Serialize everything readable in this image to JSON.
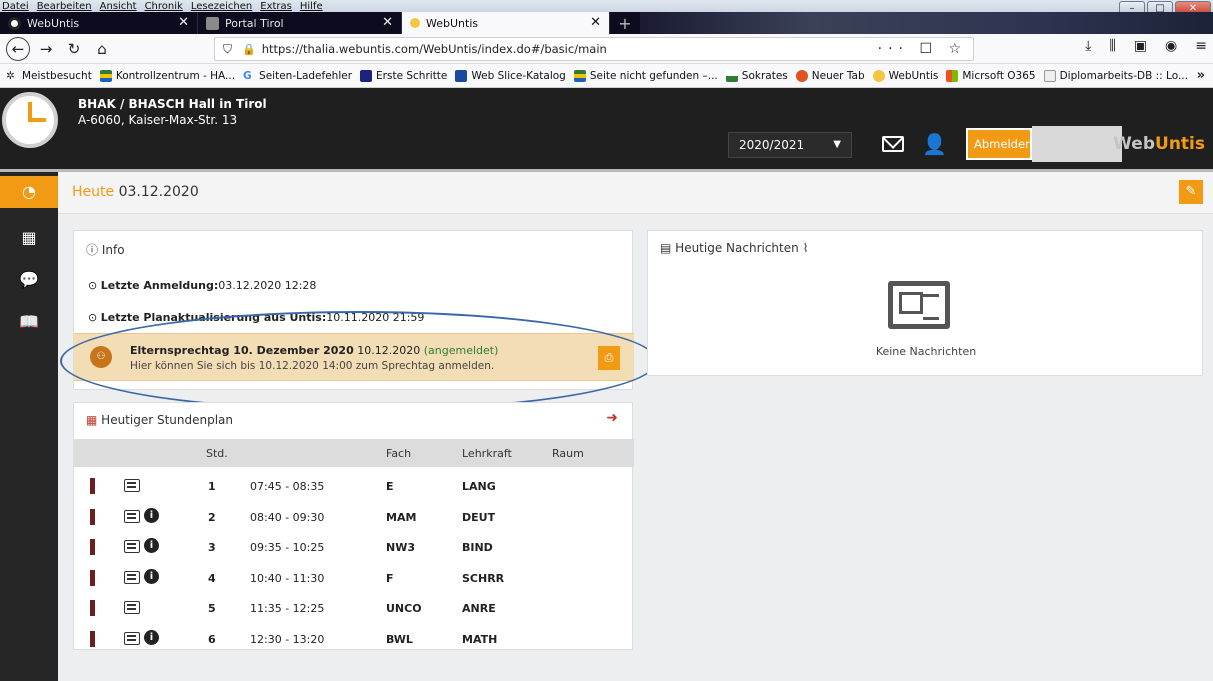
{
  "menubar": [
    "Datei",
    "Bearbeiten",
    "Ansicht",
    "Chronik",
    "Lesezeichen",
    "Extras",
    "Hilfe"
  ],
  "tabs": [
    {
      "label": "WebUntis"
    },
    {
      "label": "Portal Tirol"
    },
    {
      "label": "WebUntis"
    }
  ],
  "nav": {
    "url": "https://thalia.webuntis.com/WebUntis/index.do#/basic/main",
    "url_right": "··· ☐ ☆"
  },
  "bookmarks": [
    "Meistbesucht",
    "Kontrollzentrum - HA...",
    "Seiten-Ladefehler",
    "Erste Schritte",
    "Web Slice-Katalog",
    "Seite nicht gefunden –...",
    "Sokrates",
    "Neuer Tab",
    "WebUntis",
    "Micrsoft O365",
    "Diplomarbeits-DB :: Lo..."
  ],
  "header": {
    "school_name": "BHAK / BHASCH Hall in Tirol",
    "school_address": "A-6060, Kaiser-Max-Str. 13",
    "school_year": "2020/2021",
    "logout_label": "Abmelden",
    "brand_prefix": "Web",
    "brand_suffix": "Untis"
  },
  "page": {
    "title_prefix": "Heute",
    "title_date": "03.12.2020"
  },
  "info": {
    "heading": "Info",
    "last_login_label": "Letzte Anmeldung:",
    "last_login_value": "03.12.2020 12:28",
    "last_update_label": "Letzte Planaktualisierung aus Untis:",
    "last_update_value": "10.11.2020 21:59",
    "event_title": "Elternsprechtag 10. Dezember 2020",
    "event_date": "10.12.2020",
    "event_status": "(angemeldet)",
    "event_note": "Hier können Sie sich bis 10.12.2020 14:00 zum Sprechtag anmelden."
  },
  "news": {
    "heading": "Heutige Nachrichten",
    "empty": "Keine Nachrichten"
  },
  "timetable": {
    "heading": "Heutiger Stundenplan",
    "columns": {
      "std": "Std.",
      "fach": "Fach",
      "lehrkraft": "Lehrkraft",
      "raum": "Raum"
    },
    "rows": [
      {
        "std": "1",
        "time": "07:45 - 08:35",
        "fach": "E",
        "lehrkraft": "LANG",
        "raum": "",
        "info": false
      },
      {
        "std": "2",
        "time": "08:40 - 09:30",
        "fach": "MAM",
        "lehrkraft": "DEUT",
        "raum": "",
        "info": true
      },
      {
        "std": "3",
        "time": "09:35 - 10:25",
        "fach": "NW3",
        "lehrkraft": "BIND",
        "raum": "",
        "info": true
      },
      {
        "std": "4",
        "time": "10:40 - 11:30",
        "fach": "F",
        "lehrkraft": "SCHRR",
        "raum": "",
        "info": true
      },
      {
        "std": "5",
        "time": "11:35 - 12:25",
        "fach": "UNCO",
        "lehrkraft": "ANRE",
        "raum": "",
        "info": false
      },
      {
        "std": "6",
        "time": "12:30 - 13:20",
        "fach": "BWL",
        "lehrkraft": "MATH",
        "raum": "",
        "info": true
      }
    ]
  }
}
